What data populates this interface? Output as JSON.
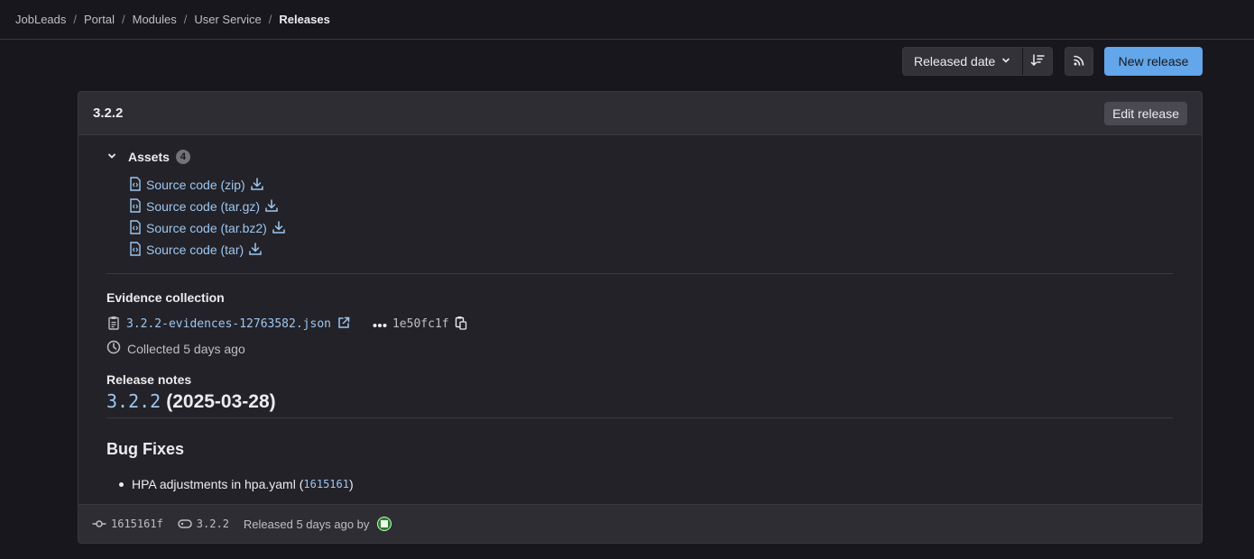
{
  "breadcrumb": [
    "JobLeads",
    "Portal",
    "Modules",
    "User Service",
    "Releases"
  ],
  "toolbar": {
    "sort_label": "Released date",
    "sort_direction_icon": "sort-descending-icon",
    "rss_icon": "rss-icon",
    "new_release_label": "New release"
  },
  "release": {
    "title": "3.2.2",
    "edit_label": "Edit release",
    "assets": {
      "label": "Assets",
      "count": "4",
      "items": [
        "Source code (zip)",
        "Source code (tar.gz)",
        "Source code (tar.bz2)",
        "Source code (tar)"
      ]
    },
    "evidence": {
      "title": "Evidence collection",
      "file": "3.2.2-evidences-12763582.json",
      "sha": "1e50fc1f",
      "collected": "Collected 5 days ago"
    },
    "notes": {
      "title": "Release notes",
      "version_link": "3.2.2",
      "date": "(2025-03-28)",
      "section": "Bug Fixes",
      "bullet_text": "HPA adjustments in hpa.yaml (",
      "bullet_commit": "1615161",
      "bullet_close": ")"
    },
    "footer": {
      "commit": "1615161f",
      "tag": "3.2.2",
      "released": "Released 5 days ago by"
    }
  },
  "colors": {
    "background": "#18171d",
    "card": "#232228",
    "link": "#9dc7f1",
    "primary_button": "#63a6e9"
  }
}
